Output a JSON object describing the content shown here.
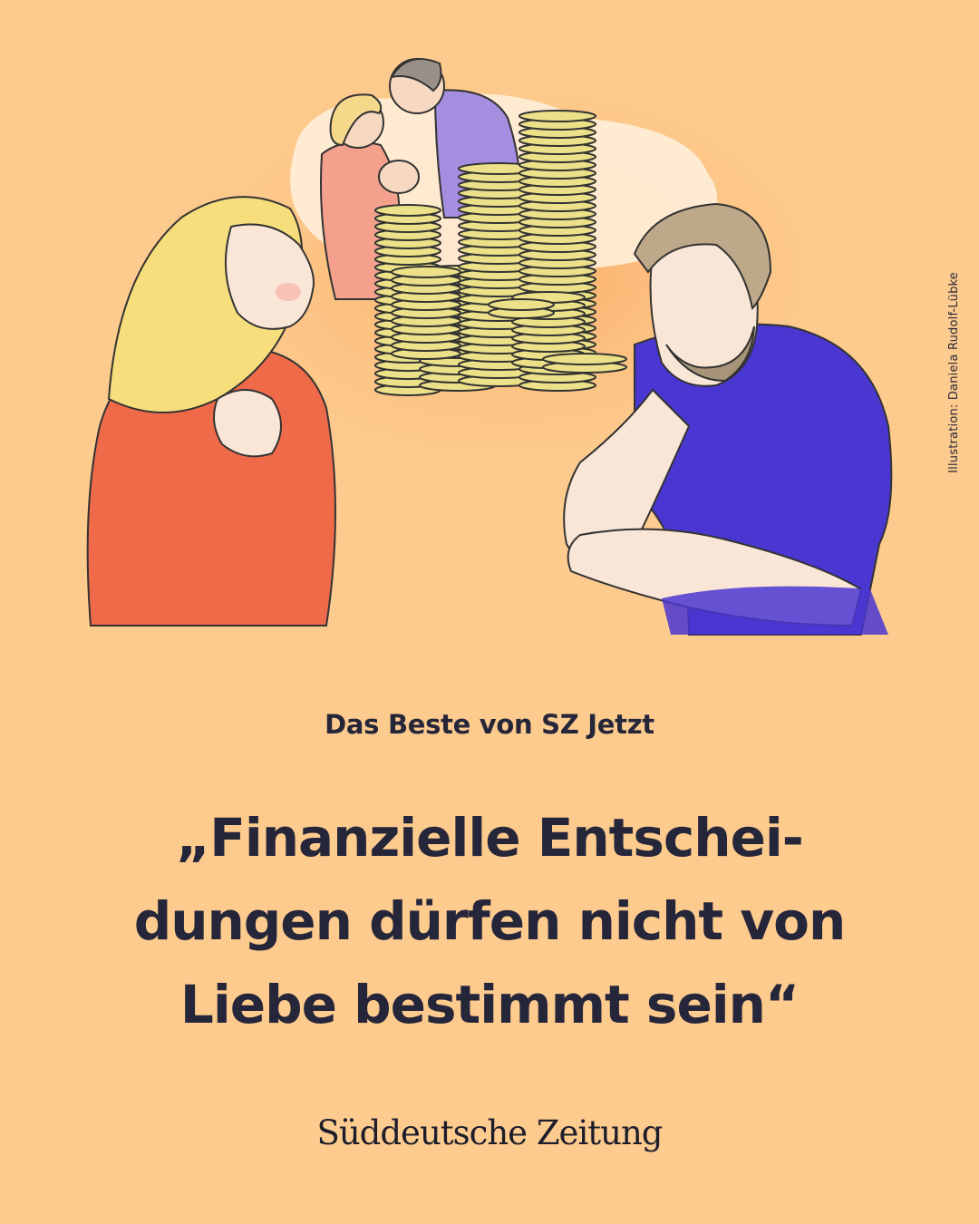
{
  "credit": "Illustration: Daniela Rudolf-Lübke",
  "kicker": "Das Beste von SZ Jetzt",
  "headline": {
    "line1": "„Finanzielle Entschei-",
    "line2": "dungen dürfen nicht von",
    "line3": "Liebe bestimmt sein“"
  },
  "logo": "Süddeutsche Zeitung",
  "colors": {
    "background": "#fdcb8e",
    "text": "#26263a",
    "woman_shirt": "#ee6a48",
    "man_shirt": "#4a36d0",
    "coins": "#ece188"
  }
}
